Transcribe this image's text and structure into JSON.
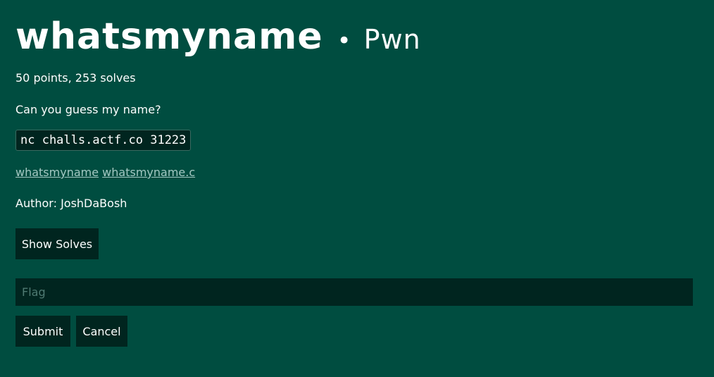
{
  "challenge": {
    "name": "whatsmyname",
    "separator": "•",
    "category": "Pwn",
    "meta": "50 points, 253 solves",
    "description": "Can you guess my name?",
    "command": "nc challs.actf.co 31223",
    "files": [
      "whatsmyname",
      "whatsmyname.c"
    ],
    "author": "Author: JoshDaBosh"
  },
  "actions": {
    "show_solves_label": "Show Solves",
    "submit_label": "Submit",
    "cancel_label": "Cancel"
  },
  "flag_input": {
    "placeholder": "Flag",
    "value": ""
  },
  "colors": {
    "background": "#004d40",
    "button_bg": "#00251f",
    "link": "#a5c8c2",
    "text": "#ffffff"
  }
}
